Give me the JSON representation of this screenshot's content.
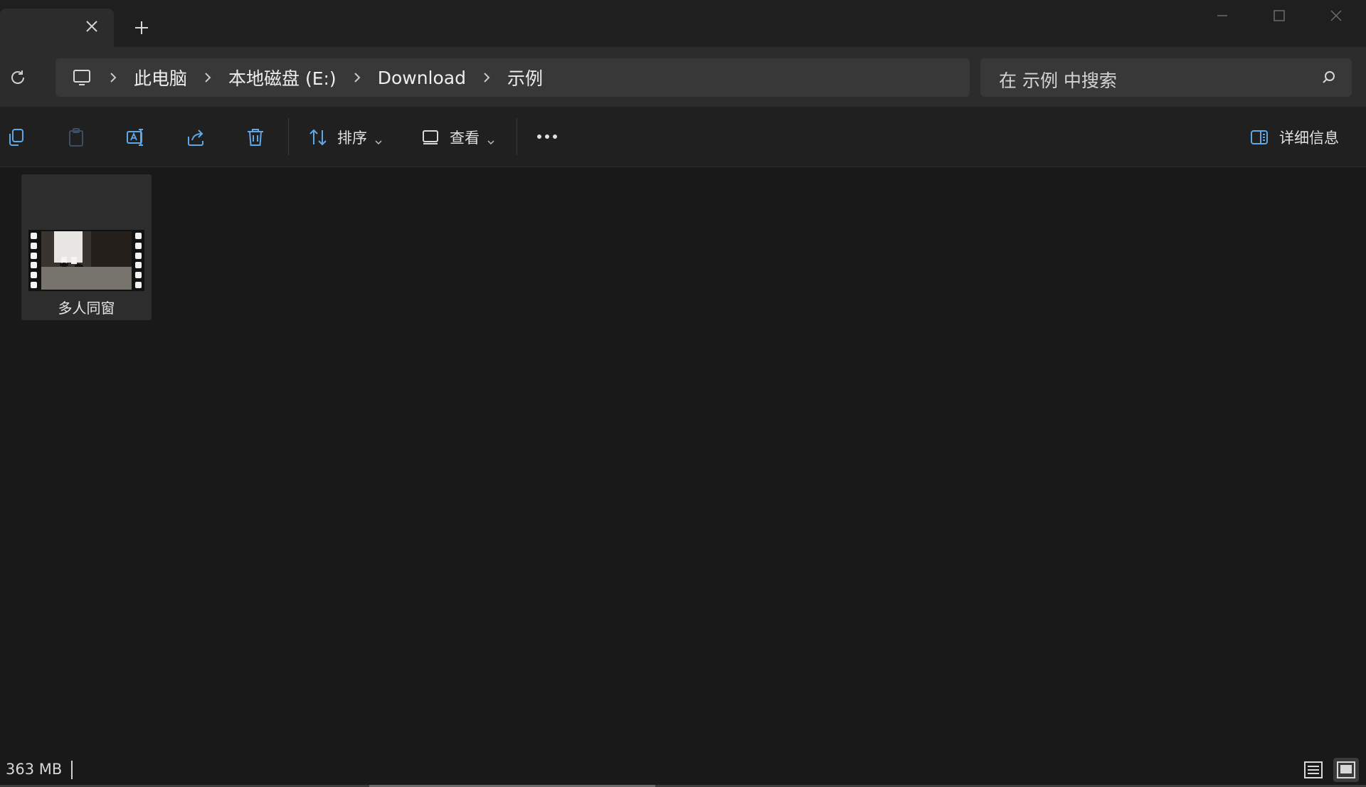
{
  "breadcrumb": {
    "items": [
      "此电脑",
      "本地磁盘 (E:)",
      "Download",
      "示例"
    ]
  },
  "search": {
    "placeholder": "在 示例 中搜索"
  },
  "toolbar": {
    "sort_label": "排序",
    "view_label": "查看",
    "details_label": "详细信息"
  },
  "files": [
    {
      "name": "多人同窗",
      "type": "video"
    }
  ],
  "status": {
    "size": "363 MB"
  },
  "colors": {
    "accent": "#5fa8e8",
    "background": "#191919"
  }
}
